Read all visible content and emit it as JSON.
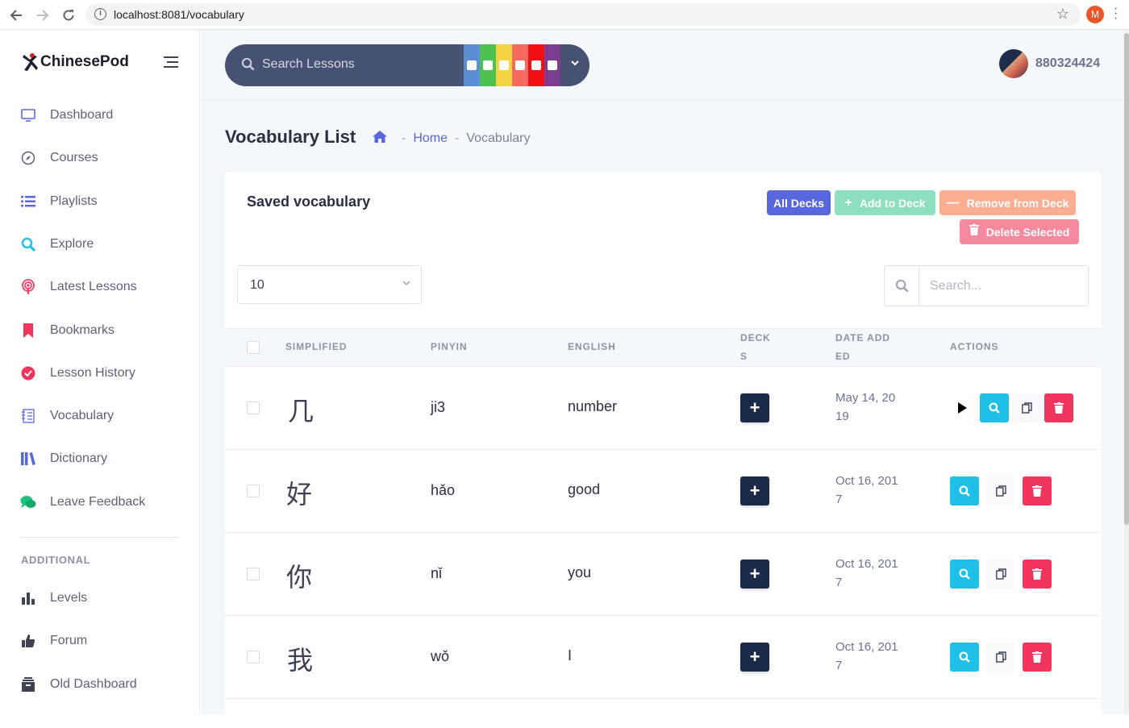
{
  "browser": {
    "url": "localhost:8081/vocabulary",
    "profile_initial": "M"
  },
  "sidebar": {
    "logo_text": "ChinesePod",
    "items": [
      {
        "label": "Dashboard",
        "icon": "monitor-icon"
      },
      {
        "label": "Courses",
        "icon": "compass-icon"
      },
      {
        "label": "Playlists",
        "icon": "list-icon"
      },
      {
        "label": "Explore",
        "icon": "search-icon"
      },
      {
        "label": "Latest Lessons",
        "icon": "podcast-icon"
      },
      {
        "label": "Bookmarks",
        "icon": "bookmark-icon"
      },
      {
        "label": "Lesson History",
        "icon": "check-circle-icon"
      },
      {
        "label": "Vocabulary",
        "icon": "notebook-icon"
      },
      {
        "label": "Dictionary",
        "icon": "books-icon"
      },
      {
        "label": "Leave Feedback",
        "icon": "chat-icon"
      }
    ],
    "section_title": "ADDITIONAL",
    "additional": [
      {
        "label": "Levels",
        "icon": "bar-chart-icon"
      },
      {
        "label": "Forum",
        "icon": "thumbs-up-icon"
      },
      {
        "label": "Old Dashboard",
        "icon": "archive-icon"
      }
    ]
  },
  "topbar": {
    "search_placeholder": "Search Lessons",
    "level_colors": [
      "#5a8fd6",
      "#4cc34f",
      "#f5d441",
      "#f46a5e",
      "#f00f12",
      "#7d3c8f"
    ],
    "username": "880324424"
  },
  "page": {
    "title": "Vocabulary List",
    "breadcrumb_home": "Home",
    "breadcrumb_current": "Vocabulary"
  },
  "card": {
    "title": "Saved vocabulary",
    "buttons": {
      "all_decks": "All Decks",
      "add_to_deck": "Add to Deck",
      "remove_from_deck": "Remove from Deck",
      "delete_selected": "Delete Selected"
    },
    "page_size": "10",
    "search_placeholder": "Search..."
  },
  "table": {
    "headers": {
      "simplified": "SIMPLIFIED",
      "pinyin": "PINYIN",
      "english": "ENGLISH",
      "decks_1": "DECK",
      "decks_2": "S",
      "date_1": "DATE ADD",
      "date_2": "ED",
      "actions": "ACTIONS"
    },
    "rows": [
      {
        "simplified": "几",
        "pinyin": "ji3",
        "english": "number",
        "date_1": "May 14, 20",
        "date_2": "19",
        "has_audio": true
      },
      {
        "simplified": "好",
        "pinyin": "hǎo",
        "english": "good",
        "date_1": "Oct 16, 201",
        "date_2": "7",
        "has_audio": false
      },
      {
        "simplified": "你",
        "pinyin": "nǐ",
        "english": "you",
        "date_1": "Oct 16, 201",
        "date_2": "7",
        "has_audio": false
      },
      {
        "simplified": "我",
        "pinyin": "wǒ",
        "english": "I",
        "date_1": "Oct 16, 201",
        "date_2": "7",
        "has_audio": false
      }
    ]
  }
}
